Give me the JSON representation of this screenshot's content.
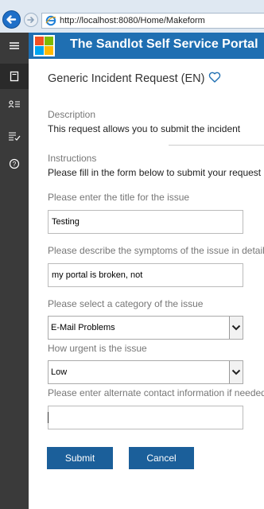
{
  "browser": {
    "url": "http://localhost:8080/Home/Makeform"
  },
  "header": {
    "title": "The Sandlot Self Service Portal"
  },
  "form": {
    "title": "Generic Incident Request (EN)",
    "description_label": "Description",
    "description_text": "This request allows you to submit the incident",
    "instructions_label": "Instructions",
    "instructions_text": "Please fill in the form below to submit your request",
    "q_title": "Please enter the title for the issue",
    "a_title": "Testing",
    "q_symptoms": "Please describe the symptoms of the issue in detail",
    "a_symptoms": "my portal is broken, not",
    "q_category": "Please select a category of the issue",
    "a_category": "E-Mail Problems",
    "q_urgency": "How urgent is the issue",
    "a_urgency": "Low",
    "q_contact": "Please enter alternate contact information if needed",
    "a_contact": "",
    "submit_label": "Submit",
    "cancel_label": "Cancel"
  },
  "colors": {
    "header_blue": "#1f6fb2",
    "sidebar_dark": "#3a3a3a",
    "button_blue": "#1b5f9a"
  },
  "icons": {
    "sidebar": [
      "hamburger-menu-icon",
      "request-book-icon",
      "contacts-icon",
      "checklist-icon",
      "help-icon"
    ]
  }
}
